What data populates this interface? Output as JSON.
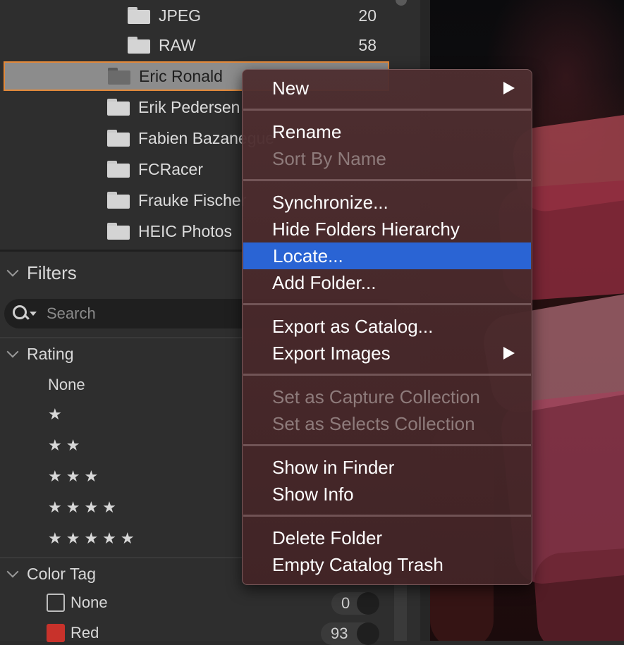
{
  "folders": [
    {
      "name": "JPEG",
      "count": "20"
    },
    {
      "name": "RAW",
      "count": "58"
    },
    {
      "name": "Eric Ronald"
    },
    {
      "name": "Erik Pedersen"
    },
    {
      "name": "Fabien Bazanegue"
    },
    {
      "name": "FCRacer"
    },
    {
      "name": "Frauke Fischer"
    },
    {
      "name": "HEIC Photos"
    }
  ],
  "filters": {
    "title": "Filters",
    "search_placeholder": "Search",
    "rating": {
      "title": "Rating",
      "rows": [
        "None",
        "★",
        "★★",
        "★★★",
        "★★★★",
        "★★★★★"
      ]
    },
    "color_tag": {
      "title": "Color Tag",
      "rows": [
        {
          "label": "None",
          "count": "0",
          "color": "none"
        },
        {
          "label": "Red",
          "count": "93",
          "color": "#c8322b"
        }
      ]
    }
  },
  "context_menu": {
    "items": [
      {
        "label": "New",
        "submenu": true
      },
      {
        "label": "Rename"
      },
      {
        "label": "Sort By Name",
        "disabled": true
      },
      {
        "label": "Synchronize..."
      },
      {
        "label": "Hide Folders Hierarchy"
      },
      {
        "label": "Locate...",
        "highlighted": true
      },
      {
        "label": "Add Folder..."
      },
      {
        "label": "Export as Catalog..."
      },
      {
        "label": "Export Images",
        "submenu": true
      },
      {
        "label": "Set as Capture Collection",
        "disabled": true
      },
      {
        "label": "Set as Selects Collection",
        "disabled": true
      },
      {
        "label": "Show in Finder"
      },
      {
        "label": "Show Info"
      },
      {
        "label": "Delete Folder"
      },
      {
        "label": "Empty Catalog Trash"
      }
    ]
  }
}
